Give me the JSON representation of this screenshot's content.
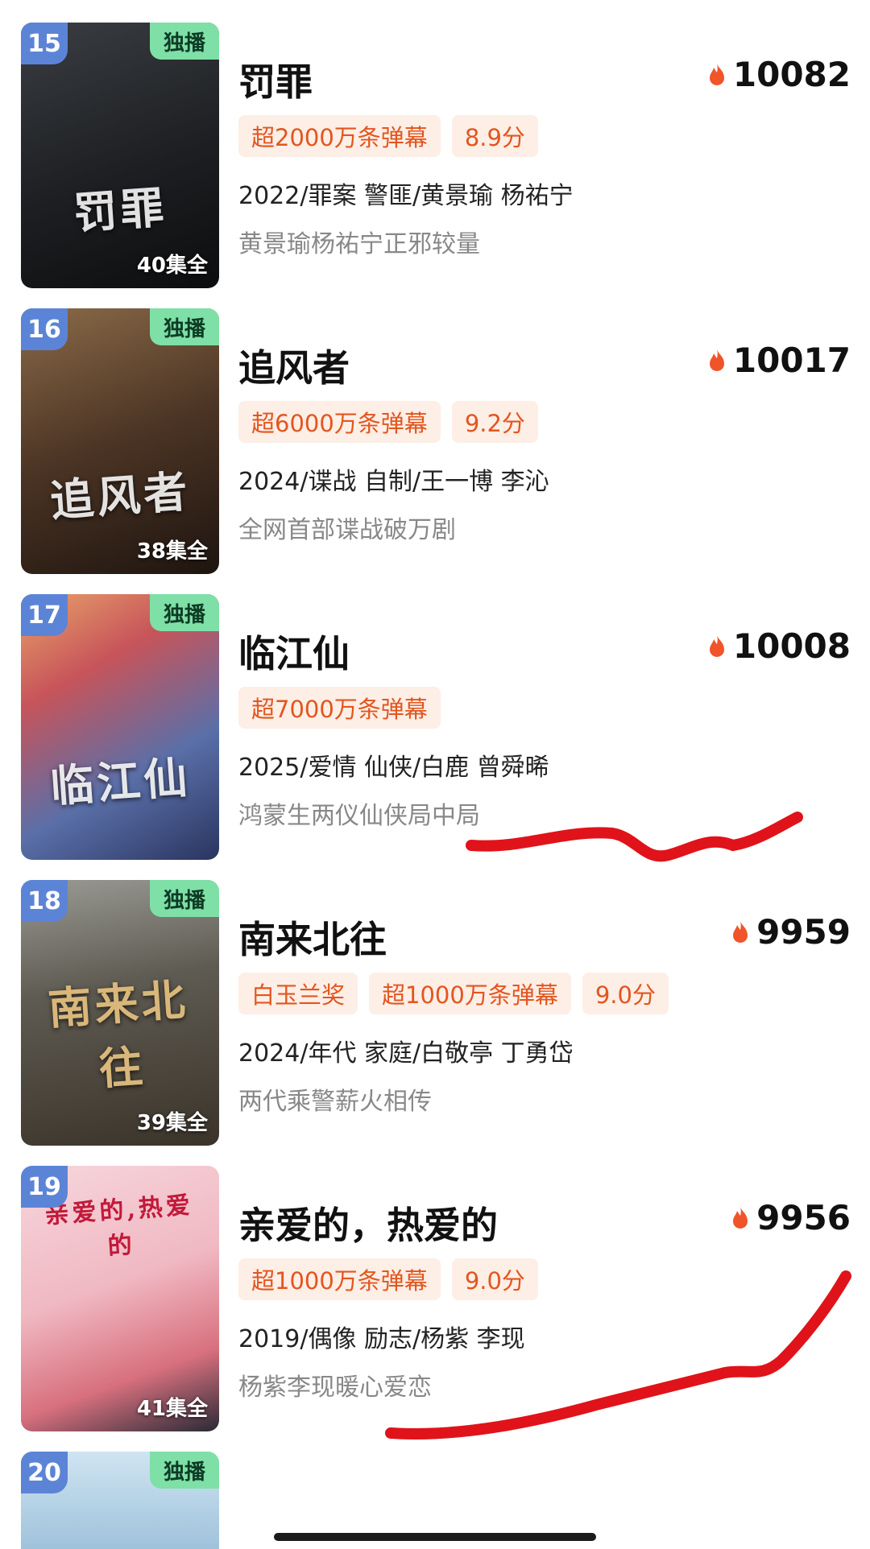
{
  "items": [
    {
      "rank": "15",
      "badge": "独播",
      "title": "罚罪",
      "heat": "10082",
      "tags": [
        "超2000万条弹幕",
        "8.9分"
      ],
      "meta": "2022/罪案 警匪/黄景瑜 杨祐宁",
      "desc": "黄景瑜杨祐宁正邪较量",
      "episodes": "40集全",
      "poster_text": "罚罪"
    },
    {
      "rank": "16",
      "badge": "独播",
      "title": "追风者",
      "heat": "10017",
      "tags": [
        "超6000万条弹幕",
        "9.2分"
      ],
      "meta": "2024/谍战 自制/王一博 李沁",
      "desc": "全网首部谍战破万剧",
      "episodes": "38集全",
      "poster_text": "追风者"
    },
    {
      "rank": "17",
      "badge": "独播",
      "title": "临江仙",
      "heat": "10008",
      "tags": [
        "超7000万条弹幕"
      ],
      "meta": "2025/爱情 仙侠/白鹿 曾舜晞",
      "desc": "鸿蒙生两仪仙侠局中局",
      "episodes": "",
      "poster_text": "临江仙"
    },
    {
      "rank": "18",
      "badge": "独播",
      "title": "南来北往",
      "heat": "9959",
      "tags": [
        "白玉兰奖",
        "超1000万条弹幕",
        "9.0分"
      ],
      "meta": "2024/年代 家庭/白敬亭 丁勇岱",
      "desc": "两代乘警薪火相传",
      "episodes": "39集全",
      "poster_text": "南来北往"
    },
    {
      "rank": "19",
      "badge": "",
      "title": "亲爱的，热爱的",
      "heat": "9956",
      "tags": [
        "超1000万条弹幕",
        "9.0分"
      ],
      "meta": "2019/偶像 励志/杨紫 李现",
      "desc": "杨紫李现暖心爱恋",
      "episodes": "41集全",
      "poster_text": "亲爱的,热爱的"
    },
    {
      "rank": "20",
      "badge": "独播",
      "title": "",
      "heat": "",
      "tags": [],
      "meta": "",
      "desc": "",
      "episodes": "",
      "poster_text": ""
    }
  ],
  "colors": {
    "tag_bg": "#fdeee6",
    "tag_text": "#e2561f",
    "rank_bg": "#5c84d6",
    "exclusive_bg": "#7ee0a6",
    "fire": "#f0542a",
    "annotation": "#e0131a"
  },
  "icons": {
    "heat": "fire-icon"
  }
}
